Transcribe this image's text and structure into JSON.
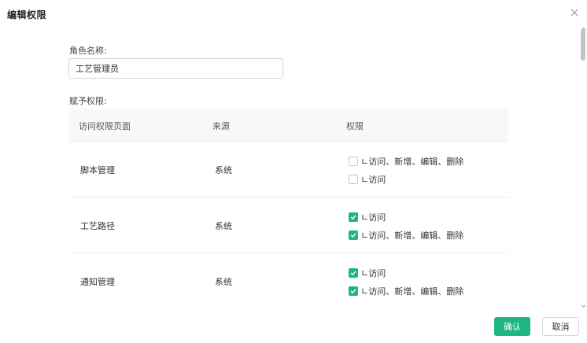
{
  "dialog": {
    "title": "编辑权限",
    "close_icon": "close-icon",
    "role_label": "角色名称:",
    "role_value": "工艺管理员",
    "perm_label": "赋予权限:",
    "ok_label": "确认",
    "cancel_label": "取消"
  },
  "table": {
    "headers": {
      "page": "访问权限页面",
      "source": "来源",
      "perm": "权限"
    },
    "rows": [
      {
        "page": "脚本管理",
        "source": "系统",
        "perms": [
          {
            "text": "∟访问、新增、编辑、删除",
            "checked": false
          },
          {
            "text": "∟访问",
            "checked": false
          }
        ]
      },
      {
        "page": "工艺路径",
        "source": "系统",
        "perms": [
          {
            "text": "∟访问",
            "checked": true
          },
          {
            "text": "∟访问、新增、编辑、删除",
            "checked": true
          }
        ]
      },
      {
        "page": "通知管理",
        "source": "系统",
        "perms": [
          {
            "text": "∟访问",
            "checked": true
          },
          {
            "text": "∟访问、新增、编辑、删除",
            "checked": true
          }
        ]
      }
    ]
  },
  "colors": {
    "accent": "#1cb583",
    "header_bg": "#f7f8fa",
    "border": "#d6d6d6"
  }
}
